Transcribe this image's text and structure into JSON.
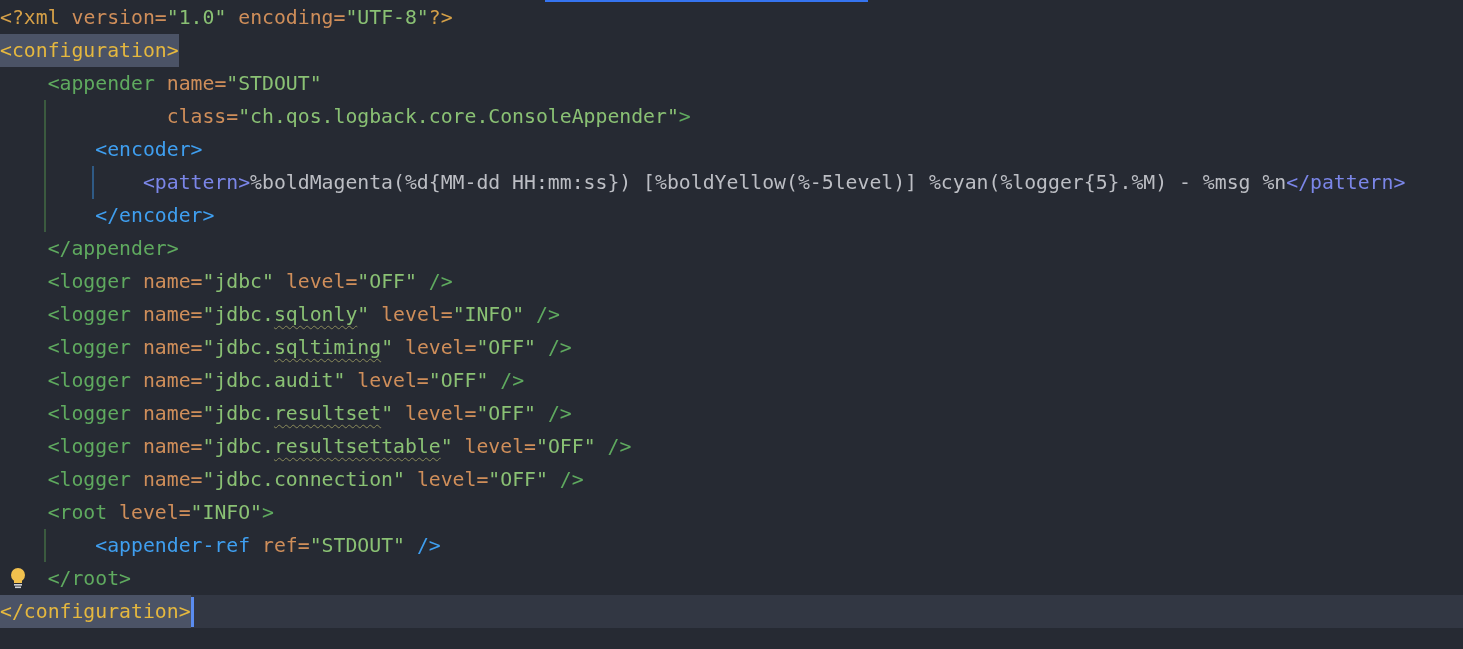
{
  "editor": {
    "lines": [
      {
        "tokens": [
          {
            "kind": "decl",
            "text": "<?xml "
          },
          {
            "kind": "attr",
            "text": "version="
          },
          {
            "kind": "value",
            "text": "\"1.0\""
          },
          {
            "kind": "attr",
            "text": " encoding="
          },
          {
            "kind": "value",
            "text": "\"UTF-8\""
          },
          {
            "kind": "decl",
            "text": "?>"
          }
        ]
      },
      {
        "tokens": [
          {
            "kind": "tag_yellow",
            "text": "<configuration>",
            "matched": true
          }
        ]
      },
      {
        "tokens": [
          {
            "kind": "tag_green",
            "text": "    <appender"
          },
          {
            "kind": "attr",
            "text": " name="
          },
          {
            "kind": "value",
            "text": "\"STDOUT\""
          }
        ]
      },
      {
        "guides": [
          {
            "kind": "tag_green"
          }
        ],
        "tokens": [
          {
            "kind": "attr",
            "text": "              class="
          },
          {
            "kind": "value",
            "text": "\"ch.qos.logback.core.ConsoleAppender\""
          },
          {
            "kind": "tag_green",
            "text": ">"
          }
        ]
      },
      {
        "guides": [
          {
            "kind": "tag_green"
          }
        ],
        "tokens": [
          {
            "kind": "tag_blue",
            "text": "        <encoder>"
          }
        ]
      },
      {
        "guides": [
          {
            "kind": "tag_green"
          },
          {
            "kind": "tag_blue"
          }
        ],
        "tokens": [
          {
            "kind": "tag_purple",
            "text": "            <pattern>"
          },
          {
            "kind": "text",
            "text": "%boldMagenta(%d{MM-dd HH:mm:ss}) [%boldYellow(%-5level)] %cyan(%logger{5}.%M) - %msg %n"
          },
          {
            "kind": "tag_purple",
            "text": "</pattern>"
          }
        ]
      },
      {
        "guides": [
          {
            "kind": "tag_green"
          }
        ],
        "tokens": [
          {
            "kind": "tag_blue",
            "text": "        </encoder>"
          }
        ]
      },
      {
        "tokens": [
          {
            "kind": "tag_green",
            "text": "    </appender>"
          }
        ]
      },
      {
        "tokens": [
          {
            "kind": "tag_green",
            "text": "    <logger"
          },
          {
            "kind": "attr",
            "text": " name="
          },
          {
            "kind": "value",
            "text": "\"jdbc\""
          },
          {
            "kind": "attr",
            "text": " level="
          },
          {
            "kind": "value",
            "text": "\"OFF\""
          },
          {
            "kind": "tag_green",
            "text": " />"
          }
        ]
      },
      {
        "tokens": [
          {
            "kind": "tag_green",
            "text": "    <logger"
          },
          {
            "kind": "attr",
            "text": " name="
          },
          {
            "kind": "value",
            "text": "\"jdbc."
          },
          {
            "kind": "value",
            "text": "sqlonly",
            "warning": true
          },
          {
            "kind": "value",
            "text": "\""
          },
          {
            "kind": "attr",
            "text": " level="
          },
          {
            "kind": "value",
            "text": "\"INFO\""
          },
          {
            "kind": "tag_green",
            "text": " />"
          }
        ]
      },
      {
        "tokens": [
          {
            "kind": "tag_green",
            "text": "    <logger"
          },
          {
            "kind": "attr",
            "text": " name="
          },
          {
            "kind": "value",
            "text": "\"jdbc."
          },
          {
            "kind": "value",
            "text": "sqltiming",
            "warning": true
          },
          {
            "kind": "value",
            "text": "\""
          },
          {
            "kind": "attr",
            "text": " level="
          },
          {
            "kind": "value",
            "text": "\"OFF\""
          },
          {
            "kind": "tag_green",
            "text": " />"
          }
        ]
      },
      {
        "tokens": [
          {
            "kind": "tag_green",
            "text": "    <logger"
          },
          {
            "kind": "attr",
            "text": " name="
          },
          {
            "kind": "value",
            "text": "\"jdbc.audit\""
          },
          {
            "kind": "attr",
            "text": " level="
          },
          {
            "kind": "value",
            "text": "\"OFF\""
          },
          {
            "kind": "tag_green",
            "text": " />"
          }
        ]
      },
      {
        "tokens": [
          {
            "kind": "tag_green",
            "text": "    <logger"
          },
          {
            "kind": "attr",
            "text": " name="
          },
          {
            "kind": "value",
            "text": "\"jdbc."
          },
          {
            "kind": "value",
            "text": "resultset",
            "warning": true
          },
          {
            "kind": "value",
            "text": "\""
          },
          {
            "kind": "attr",
            "text": " level="
          },
          {
            "kind": "value",
            "text": "\"OFF\""
          },
          {
            "kind": "tag_green",
            "text": " />"
          }
        ]
      },
      {
        "tokens": [
          {
            "kind": "tag_green",
            "text": "    <logger"
          },
          {
            "kind": "attr",
            "text": " name="
          },
          {
            "kind": "value",
            "text": "\"jdbc."
          },
          {
            "kind": "value",
            "text": "resultsettable",
            "warning": true
          },
          {
            "kind": "value",
            "text": "\""
          },
          {
            "kind": "attr",
            "text": " level="
          },
          {
            "kind": "value",
            "text": "\"OFF\""
          },
          {
            "kind": "tag_green",
            "text": " />"
          }
        ]
      },
      {
        "tokens": [
          {
            "kind": "tag_green",
            "text": "    <logger"
          },
          {
            "kind": "attr",
            "text": " name="
          },
          {
            "kind": "value",
            "text": "\"jdbc.connection\""
          },
          {
            "kind": "attr",
            "text": " level="
          },
          {
            "kind": "value",
            "text": "\"OFF\""
          },
          {
            "kind": "tag_green",
            "text": " />"
          }
        ]
      },
      {
        "tokens": [
          {
            "kind": "tag_green",
            "text": "    <root"
          },
          {
            "kind": "attr",
            "text": " level="
          },
          {
            "kind": "value",
            "text": "\"INFO\""
          },
          {
            "kind": "tag_green",
            "text": ">"
          }
        ]
      },
      {
        "guides": [
          {
            "kind": "tag_green"
          }
        ],
        "tokens": [
          {
            "kind": "tag_blue",
            "text": "        <appender-ref"
          },
          {
            "kind": "attr",
            "text": " ref="
          },
          {
            "kind": "value",
            "text": "\"STDOUT\""
          },
          {
            "kind": "tag_blue",
            "text": " />"
          }
        ]
      },
      {
        "bulb": true,
        "tokens": [
          {
            "kind": "tag_green",
            "text": "    </root>"
          }
        ]
      },
      {
        "current": true,
        "caret": true,
        "tokens": [
          {
            "kind": "tag_yellow",
            "text": "</configuration>",
            "matched": true
          }
        ]
      }
    ]
  }
}
